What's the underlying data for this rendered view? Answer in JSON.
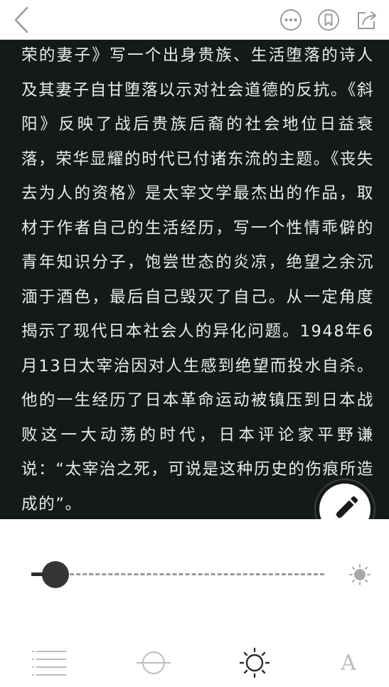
{
  "toolbar": {
    "back_icon": "chevron-left-icon",
    "more_icon": "more-options-icon",
    "bookmark_icon": "bookmark-icon",
    "share_icon": "share-icon"
  },
  "reader": {
    "text": "荣的妻子》写一个出身贵族、生活堕落的诗人及其妻子自甘堕落以示对社会道德的反抗。《斜阳》反映了战后贵族后裔的社会地位日益衰落，荣华显耀的时代已付诸东流的主题。《丧失去为人的资格》是太宰文学最杰出的作品，取材于作者自己的生活经历，写一个性情乖僻的青年知识分子，饱尝世态的炎凉，绝望之余沉湎于酒色，最后自己毁灭了自己。从一定角度揭示了现代日本社会人的异化问题。1948年6月13日太宰治因对人生感到绝望而投水自杀。他的一生经历了日本革命运动被镇压到日本战败这一大动荡的时代，日本评论家平野谦说：“太宰治之死，可说是这种历史的伤痕所造成的”。",
    "background_color": "#131a19",
    "text_color": "#e9eceb"
  },
  "edit_button": {
    "icon": "pencil-icon"
  },
  "brightness": {
    "level": 0.05,
    "icon": "sun-icon"
  },
  "bottom_nav": {
    "items": [
      {
        "icon": "catalog-icon"
      },
      {
        "icon": "progress-icon"
      },
      {
        "icon": "brightness-icon"
      },
      {
        "icon": "font-icon",
        "label": "A"
      }
    ]
  }
}
